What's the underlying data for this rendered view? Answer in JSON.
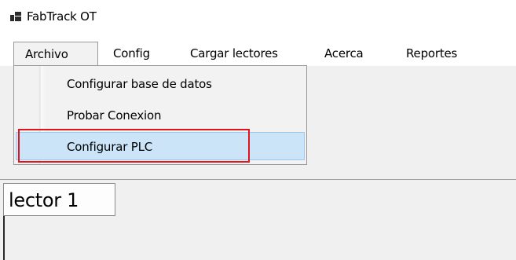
{
  "window": {
    "title": "FabTrack OT",
    "icon": "app-icon"
  },
  "menubar": {
    "items": [
      {
        "label": "Archivo"
      },
      {
        "label": "Config"
      },
      {
        "label": "Cargar lectores"
      },
      {
        "label": "Acerca"
      },
      {
        "label": "Reportes"
      }
    ],
    "open_menu": "Archivo"
  },
  "dropdown": {
    "items": [
      {
        "label": "Configurar base de datos"
      },
      {
        "label": "Probar Conexion"
      },
      {
        "label": "Configurar PLC"
      }
    ],
    "highlighted": "Configurar PLC"
  },
  "tabs": [
    {
      "label": "lector 1"
    }
  ],
  "colors": {
    "highlight_fill": "#cce4f7",
    "highlight_border": "#99c9ef",
    "annotation_box": "#e0141d"
  }
}
